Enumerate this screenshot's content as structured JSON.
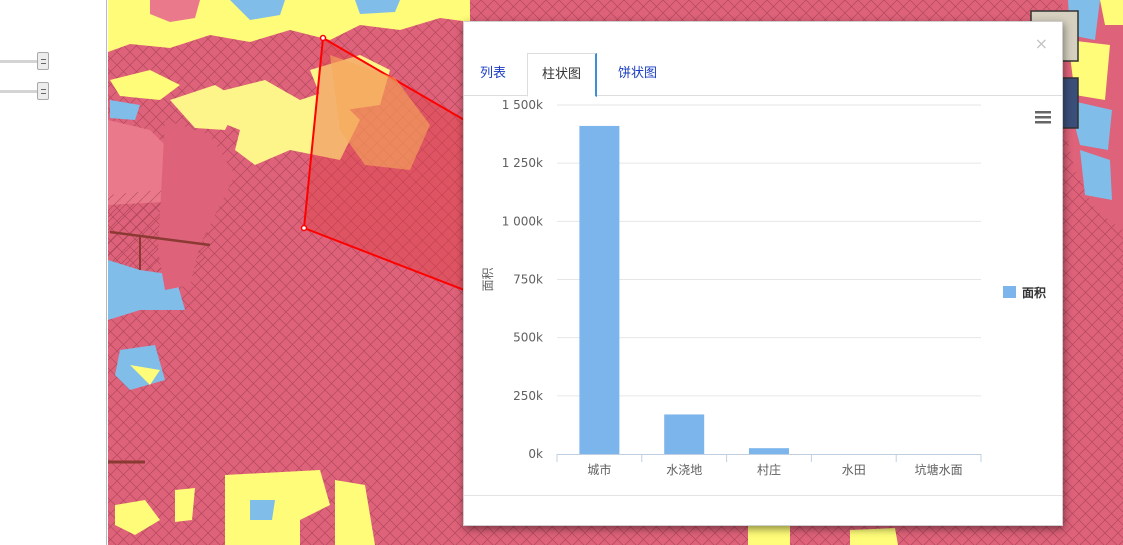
{
  "dialog": {
    "close_label": "×",
    "tabs": [
      {
        "label": "列表",
        "active": false
      },
      {
        "label": "柱状图",
        "active": true
      },
      {
        "label": "饼状图",
        "active": false
      }
    ]
  },
  "chart_data": {
    "type": "bar",
    "categories": [
      "城市",
      "水浇地",
      "村庄",
      "水田",
      "坑塘水面"
    ],
    "series": [
      {
        "name": "面积",
        "values": [
          1410000,
          170000,
          25000,
          0,
          0
        ],
        "color": "#7cb5ec"
      }
    ],
    "ylabel": "面积",
    "ylim": [
      0,
      1500000
    ],
    "yticks": [
      0,
      250000,
      500000,
      750000,
      1000000,
      1250000,
      1500000
    ],
    "ytick_labels": [
      "0k",
      "250k",
      "500k",
      "750k",
      "1 000k",
      "1 250k",
      "1 500k"
    ],
    "legend": "right",
    "grid": true
  },
  "colors": {
    "map_pink": "#de6279",
    "map_yellow": "#fefc78",
    "map_light_yellow": "#fdf48a",
    "map_blue": "#80bde9",
    "selection_red": "#ff0000",
    "tab_link": "#1a3dc1"
  },
  "icons": {
    "close": "close-icon",
    "menu": "hamburger-menu-icon"
  }
}
